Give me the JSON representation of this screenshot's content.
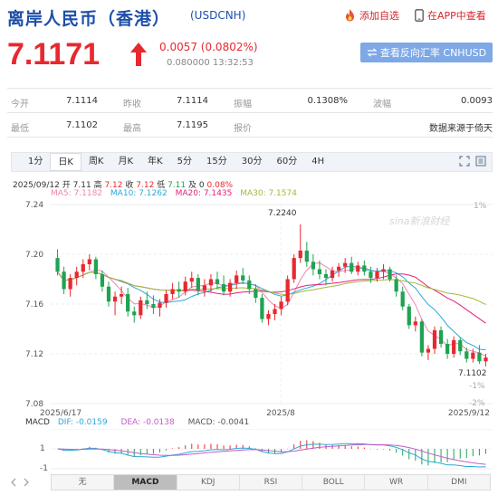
{
  "header": {
    "title": "离岸人民币（香港）",
    "code": "(USDCNH)",
    "add_fav": "添加自选",
    "app_view": "在APP中查看"
  },
  "quote": {
    "price": "7.1171",
    "change": "0.0057 (0.0802%)",
    "time": "0.080000 13:32:53",
    "reverse_button": "查看反向汇率 CNHUSD"
  },
  "stats": {
    "row1": [
      {
        "label": "今开",
        "value": "7.1114"
      },
      {
        "label": "昨收",
        "value": "7.1114"
      },
      {
        "label": "振幅",
        "value": "0.1308%"
      },
      {
        "label": "波幅",
        "value": "0.0093"
      }
    ],
    "row2": [
      {
        "label": "最低",
        "value": "7.1102"
      },
      {
        "label": "最高",
        "value": "7.1195"
      },
      {
        "label": "报价",
        "value": "数据来源于倚天"
      }
    ]
  },
  "tabs": [
    "1分",
    "日K",
    "周K",
    "月K",
    "年K",
    "5分",
    "15分",
    "30分",
    "60分",
    "4H"
  ],
  "active_tab": "日K",
  "chart_info": {
    "ohlc_line": [
      "2025/09/12",
      "开",
      "7.11",
      "高",
      "7.12",
      "收",
      "7.12",
      "低",
      "7.11",
      "及",
      "0",
      "0.08%"
    ],
    "ma_line": [
      "MA5: 7.1182",
      "MA10: 7.1262",
      "MA20: 7.1435",
      "MA30: 7.1574"
    ],
    "max_label": "7.2240",
    "min_label": "7.1102",
    "watermark": "sina新浪财经",
    "right_pct": [
      "1%",
      "-1%",
      "-2%"
    ],
    "macd_line": [
      "MACD",
      "DIF: -0.0159",
      "DEA: -0.0138",
      "MACD: -0.0041"
    ],
    "macd_ticks": [
      "1",
      "-1"
    ]
  },
  "indicators": [
    "无",
    "MACD",
    "KDJ",
    "RSI",
    "BOLL",
    "WR",
    "DMI"
  ],
  "active_indicator": "MACD",
  "colors": {
    "up": "#e8282f",
    "down": "#1fa351",
    "ma5": "#ee87b0",
    "ma10": "#2ba9d8",
    "ma20": "#e5207a",
    "ma30": "#a3b93b",
    "title": "#1e4fa8"
  },
  "chart_data": {
    "type": "candlestick",
    "x_ticks": [
      "2025/6/17",
      "2025/8",
      "2025/9/12"
    ],
    "y_ticks": [
      7.24,
      7.2,
      7.16,
      7.12,
      7.08
    ],
    "ylim": [
      7.08,
      7.24
    ],
    "ohlc": [
      [
        7.197,
        7.204,
        7.183,
        7.186
      ],
      [
        7.186,
        7.19,
        7.168,
        7.172
      ],
      [
        7.172,
        7.184,
        7.166,
        7.181
      ],
      [
        7.181,
        7.19,
        7.175,
        7.186
      ],
      [
        7.186,
        7.196,
        7.181,
        7.192
      ],
      [
        7.192,
        7.2,
        7.187,
        7.196
      ],
      [
        7.196,
        7.198,
        7.18,
        7.184
      ],
      [
        7.184,
        7.187,
        7.17,
        7.174
      ],
      [
        7.174,
        7.178,
        7.158,
        7.162
      ],
      [
        7.162,
        7.17,
        7.151,
        7.166
      ],
      [
        7.166,
        7.174,
        7.16,
        7.168
      ],
      [
        7.168,
        7.173,
        7.15,
        7.154
      ],
      [
        7.154,
        7.158,
        7.145,
        7.151
      ],
      [
        7.151,
        7.166,
        7.148,
        7.163
      ],
      [
        7.163,
        7.17,
        7.156,
        7.16
      ],
      [
        7.16,
        7.167,
        7.152,
        7.157
      ],
      [
        7.157,
        7.164,
        7.15,
        7.161
      ],
      [
        7.161,
        7.171,
        7.157,
        7.168
      ],
      [
        7.168,
        7.177,
        7.164,
        7.172
      ],
      [
        7.172,
        7.178,
        7.165,
        7.17
      ],
      [
        7.17,
        7.182,
        7.167,
        7.178
      ],
      [
        7.178,
        7.186,
        7.173,
        7.181
      ],
      [
        7.181,
        7.184,
        7.167,
        7.171
      ],
      [
        7.171,
        7.18,
        7.166,
        7.175
      ],
      [
        7.175,
        7.184,
        7.17,
        7.18
      ],
      [
        7.18,
        7.186,
        7.172,
        7.176
      ],
      [
        7.176,
        7.183,
        7.167,
        7.17
      ],
      [
        7.17,
        7.18,
        7.166,
        7.177
      ],
      [
        7.177,
        7.187,
        7.172,
        7.183
      ],
      [
        7.183,
        7.189,
        7.176,
        7.179
      ],
      [
        7.179,
        7.183,
        7.168,
        7.172
      ],
      [
        7.172,
        7.176,
        7.161,
        7.165
      ],
      [
        7.165,
        7.168,
        7.145,
        7.148
      ],
      [
        7.148,
        7.155,
        7.143,
        7.152
      ],
      [
        7.152,
        7.16,
        7.147,
        7.156
      ],
      [
        7.156,
        7.166,
        7.151,
        7.162
      ],
      [
        7.162,
        7.183,
        7.159,
        7.18
      ],
      [
        7.18,
        7.2,
        7.177,
        7.197
      ],
      [
        7.197,
        7.224,
        7.193,
        7.203
      ],
      [
        7.203,
        7.21,
        7.19,
        7.194
      ],
      [
        7.194,
        7.2,
        7.183,
        7.188
      ],
      [
        7.188,
        7.195,
        7.18,
        7.184
      ],
      [
        7.184,
        7.188,
        7.175,
        7.181
      ],
      [
        7.181,
        7.19,
        7.178,
        7.187
      ],
      [
        7.187,
        7.193,
        7.182,
        7.19
      ],
      [
        7.19,
        7.197,
        7.185,
        7.193
      ],
      [
        7.193,
        7.198,
        7.184,
        7.186
      ],
      [
        7.186,
        7.194,
        7.183,
        7.191
      ],
      [
        7.191,
        7.195,
        7.183,
        7.186
      ],
      [
        7.186,
        7.19,
        7.177,
        7.181
      ],
      [
        7.181,
        7.189,
        7.178,
        7.186
      ],
      [
        7.186,
        7.192,
        7.18,
        7.188
      ],
      [
        7.188,
        7.19,
        7.178,
        7.18
      ],
      [
        7.18,
        7.183,
        7.166,
        7.17
      ],
      [
        7.17,
        7.174,
        7.155,
        7.158
      ],
      [
        7.158,
        7.16,
        7.14,
        7.143
      ],
      [
        7.143,
        7.15,
        7.138,
        7.146
      ],
      [
        7.146,
        7.148,
        7.118,
        7.121
      ],
      [
        7.121,
        7.127,
        7.115,
        7.124
      ],
      [
        7.124,
        7.142,
        7.12,
        7.139
      ],
      [
        7.139,
        7.142,
        7.125,
        7.128
      ],
      [
        7.128,
        7.132,
        7.116,
        7.12
      ],
      [
        7.12,
        7.134,
        7.117,
        7.131
      ],
      [
        7.131,
        7.133,
        7.119,
        7.122
      ],
      [
        7.122,
        7.125,
        7.113,
        7.116
      ],
      [
        7.116,
        7.124,
        7.113,
        7.121
      ],
      [
        7.121,
        7.127,
        7.112,
        7.114
      ],
      [
        7.114,
        7.12,
        7.11,
        7.117
      ]
    ]
  }
}
